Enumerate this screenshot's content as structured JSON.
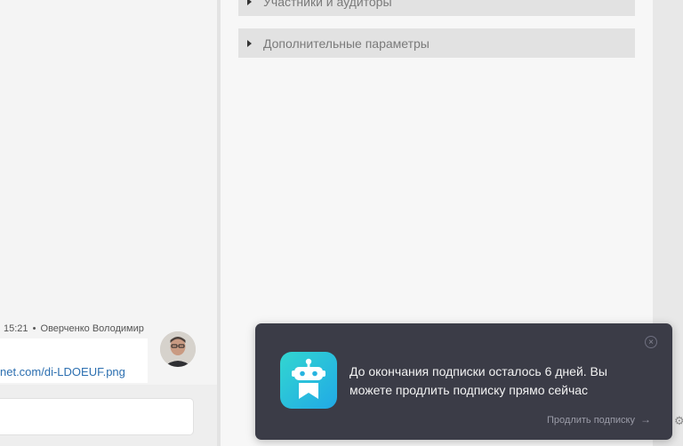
{
  "sections": [
    {
      "label": "Участники и аудиторы"
    },
    {
      "label": "Дополнительные параметры"
    }
  ],
  "chat": {
    "time": "15:21",
    "separator": "•",
    "author": "Оверченко Володимир",
    "link_text": "net.com/di-LDOEUF.png"
  },
  "notification": {
    "message": "До окончания подписки осталось 6 дней. Вы можете продлить подписку прямо сейчас",
    "action": "Продлить подписку",
    "action_arrow": "→",
    "close_glyph": "×",
    "logo_icon": "robot-icon",
    "logo_gradient": [
      "#32d6d0",
      "#21a9e6"
    ],
    "background": "#3b3c47"
  },
  "colors": {
    "link": "#2c6fb0",
    "section_bg": "#e2e2e2"
  }
}
